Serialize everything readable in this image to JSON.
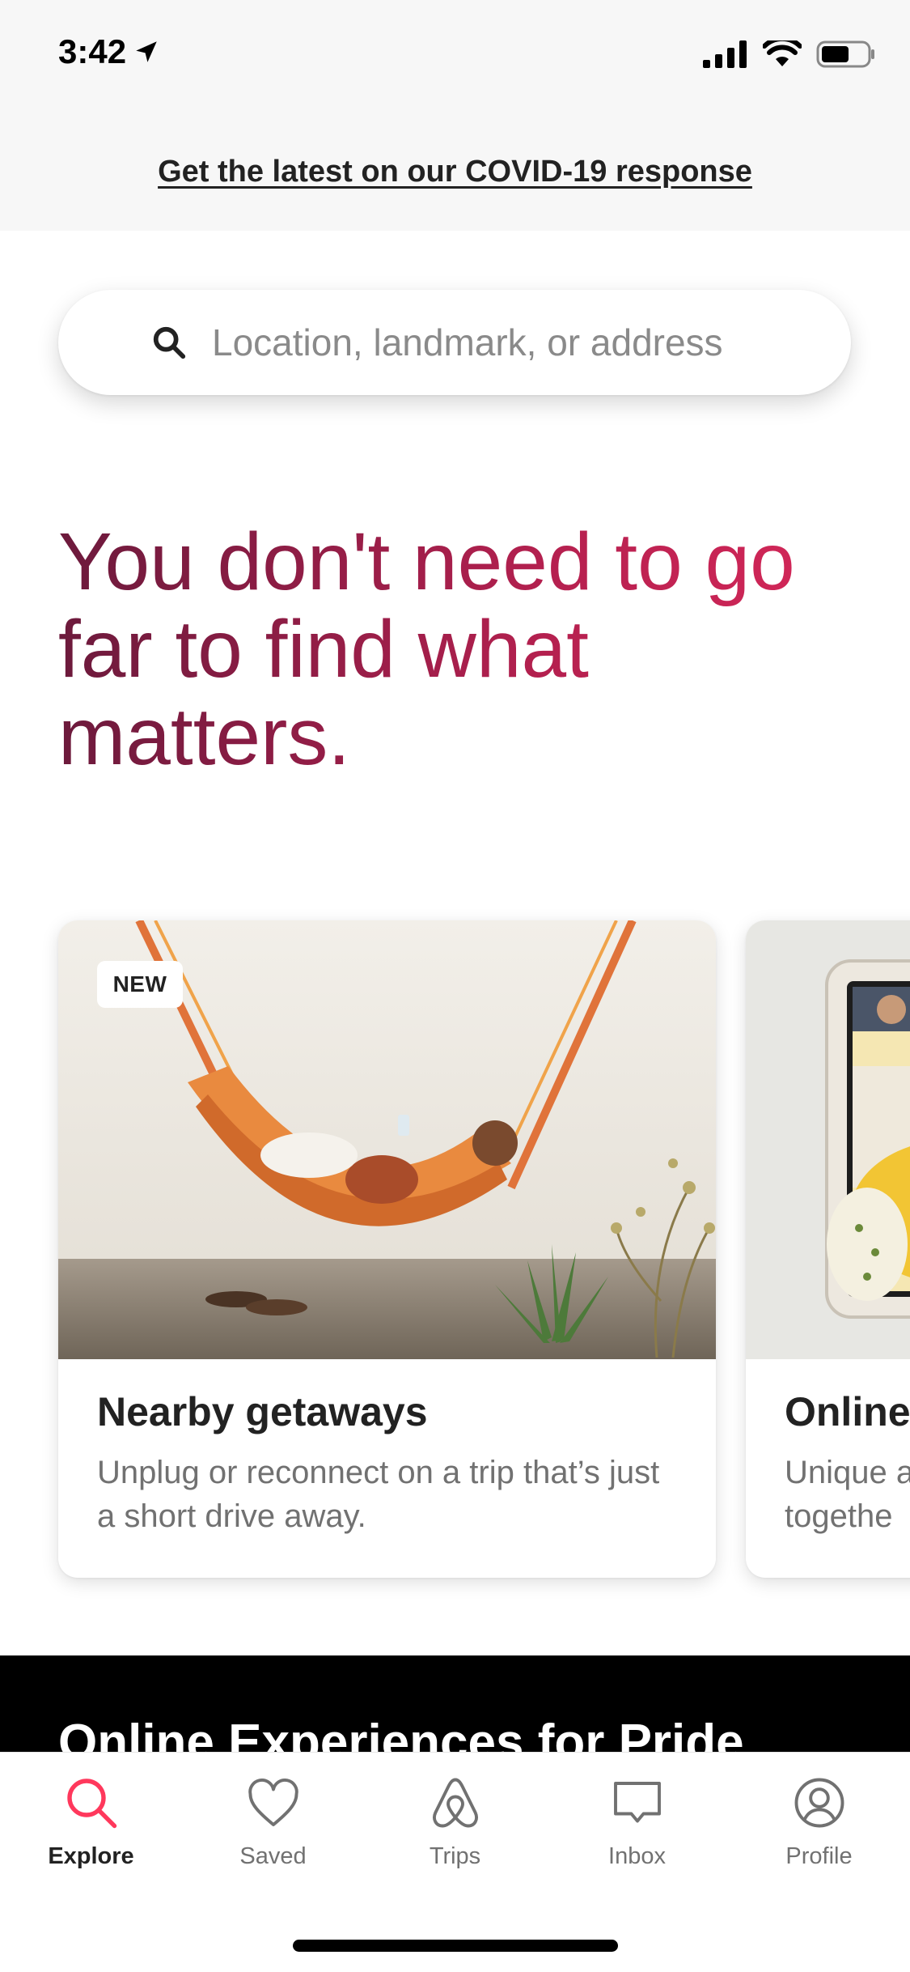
{
  "status_bar": {
    "time": "3:42"
  },
  "banner": {
    "link_text": "Get the latest on our COVID-19 response"
  },
  "search": {
    "placeholder": "Location, landmark, or address"
  },
  "headline": "You don't need to go far to find what matters.",
  "cards": [
    {
      "badge": "NEW",
      "title": "Nearby getaways",
      "description": "Unplug or reconnect on a trip that’s just a short drive away."
    },
    {
      "title": "Online",
      "description": "Unique a\ntogethe"
    }
  ],
  "section": {
    "title": "Online Experiences for Pride"
  },
  "tabs": [
    {
      "label": "Explore",
      "icon": "search-icon",
      "active": true
    },
    {
      "label": "Saved",
      "icon": "heart-icon"
    },
    {
      "label": "Trips",
      "icon": "airbnb-logo-icon"
    },
    {
      "label": "Inbox",
      "icon": "chat-icon"
    },
    {
      "label": "Profile",
      "icon": "profile-icon"
    }
  ],
  "colors": {
    "brand": "#ff385c",
    "headline_start": "#6c1a3c",
    "headline_end": "#d8285a",
    "text_primary": "#222222",
    "text_secondary": "#717171"
  }
}
